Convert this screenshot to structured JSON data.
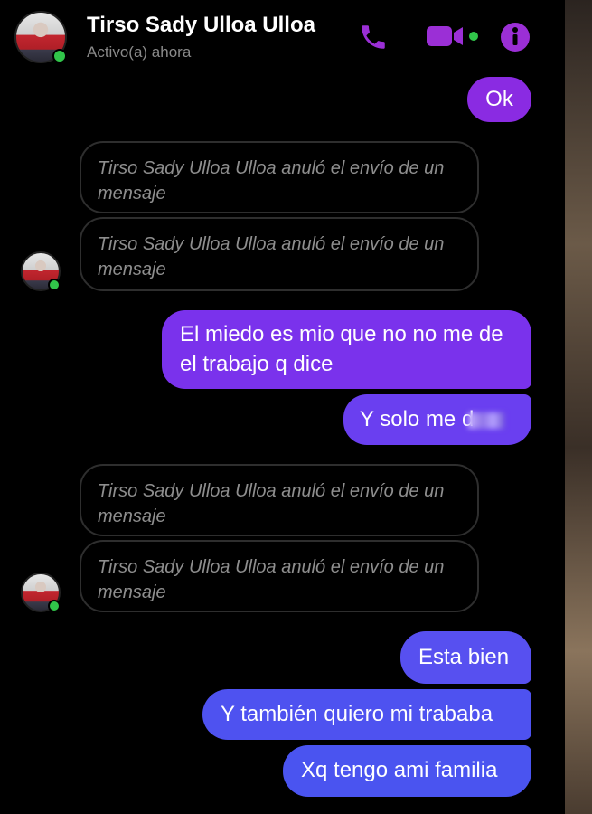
{
  "header": {
    "contact_name": "Tirso Sady Ulloa Ulloa",
    "status": "Activo(a) ahora",
    "icons": [
      "phone-icon",
      "video-camera-icon",
      "info-icon"
    ],
    "accent_color": "#9b2fd6"
  },
  "messages": [
    {
      "type": "sent",
      "text": "Ok"
    },
    {
      "type": "unsent",
      "text": "Tirso Sady Ulloa Ulloa anuló el envío de un mensaje"
    },
    {
      "type": "unsent",
      "text": "Tirso Sady Ulloa Ulloa anuló el envío de un mensaje"
    },
    {
      "type": "sent",
      "text": "El miedo es mio  que no no me de el trabajo q dice"
    },
    {
      "type": "sent",
      "text": "Y solo me d"
    },
    {
      "type": "unsent",
      "text": "Tirso Sady Ulloa Ulloa anuló el envío de un mensaje"
    },
    {
      "type": "unsent",
      "text": "Tirso Sady Ulloa Ulloa anuló el envío de un mensaje"
    },
    {
      "type": "sent",
      "text": "Esta bien"
    },
    {
      "type": "sent",
      "text": "Y también quiero mi trababa"
    },
    {
      "type": "sent",
      "text": "Xq tengo ami familia"
    }
  ],
  "colors": {
    "sent_purple": "#8a2be2",
    "sent_violet": "#6a3ff0",
    "sent_blue": "#4a54f0",
    "online_dot": "#31c54a"
  }
}
